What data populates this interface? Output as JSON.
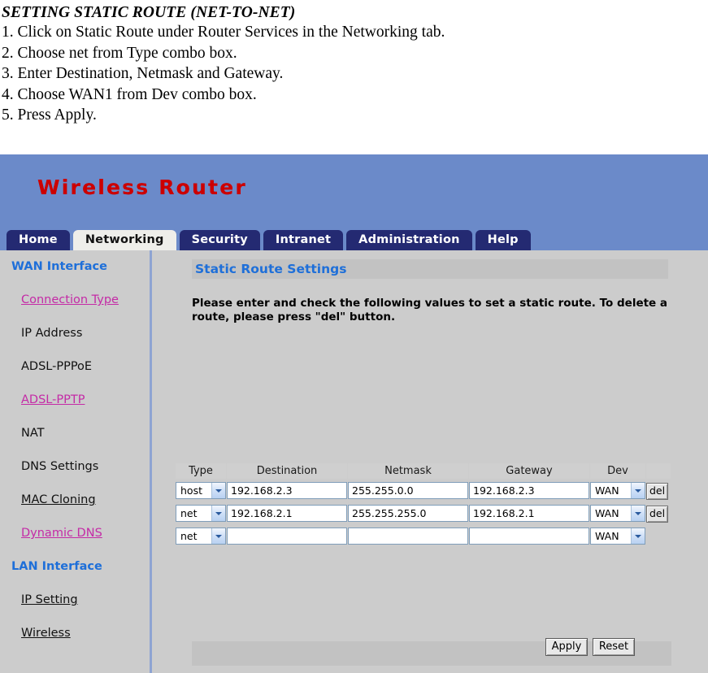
{
  "instructions": {
    "title": "SETTING STATIC ROUTE (NET-TO-NET)",
    "steps": [
      "1. Click on Static Route under Router Services in the Networking tab.",
      "2. Choose net from Type combo box.",
      "3. Enter Destination, Netmask and Gateway.",
      "4. Choose WAN1 from Dev combo box.",
      "5. Press Apply."
    ]
  },
  "router_ui": {
    "brand": "Wireless Router",
    "tabs": [
      {
        "label": "Home",
        "active": false
      },
      {
        "label": "Networking",
        "active": true
      },
      {
        "label": "Security",
        "active": false
      },
      {
        "label": "Intranet",
        "active": false
      },
      {
        "label": "Administration",
        "active": false
      },
      {
        "label": "Help",
        "active": false
      }
    ],
    "sidebar": {
      "groups": [
        {
          "label": "WAN Interface",
          "items": [
            {
              "label": "Connection Type",
              "style": "visited"
            },
            {
              "label": "IP Address",
              "style": "plain"
            },
            {
              "label": "ADSL-PPPoE",
              "style": "plain"
            },
            {
              "label": "ADSL-PPTP",
              "style": "visited"
            },
            {
              "label": "NAT",
              "style": "plain"
            },
            {
              "label": "DNS Settings",
              "style": "plain"
            },
            {
              "label": "MAC Cloning",
              "style": "link"
            },
            {
              "label": "Dynamic DNS",
              "style": "visited"
            }
          ]
        },
        {
          "label": "LAN Interface",
          "items": [
            {
              "label": "IP Setting",
              "style": "link"
            },
            {
              "label": "Wireless",
              "style": "link"
            }
          ]
        }
      ]
    },
    "panel": {
      "title": "Static Route Settings",
      "description": "Please enter and check the following values to set a static route. To delete a route, please press \"del\" button."
    },
    "table": {
      "headers": [
        "Type",
        "Destination",
        "Netmask",
        "Gateway",
        "Dev",
        ""
      ],
      "rows": [
        {
          "type": "host",
          "destination": "192.168.2.3",
          "netmask": "255.255.0.0",
          "gateway": "192.168.2.3",
          "dev": "WAN",
          "delete_label": "del",
          "has_delete": true
        },
        {
          "type": "net",
          "destination": "192.168.2.1",
          "netmask": "255.255.255.0",
          "gateway": "192.168.2.1",
          "dev": "WAN",
          "delete_label": "del",
          "has_delete": true
        },
        {
          "type": "net",
          "destination": "",
          "netmask": "",
          "gateway": "",
          "dev": "WAN",
          "delete_label": "",
          "has_delete": false
        }
      ]
    },
    "actions": {
      "apply_label": "Apply",
      "reset_label": "Reset"
    },
    "colors": {
      "brand_text": "#cc0000",
      "header_blue": "#6b8ac9",
      "tab_navy": "#242a72",
      "heading_blue": "#1e6fd9",
      "visited_link": "#c42ba6",
      "page_gray": "#cccccc"
    }
  }
}
